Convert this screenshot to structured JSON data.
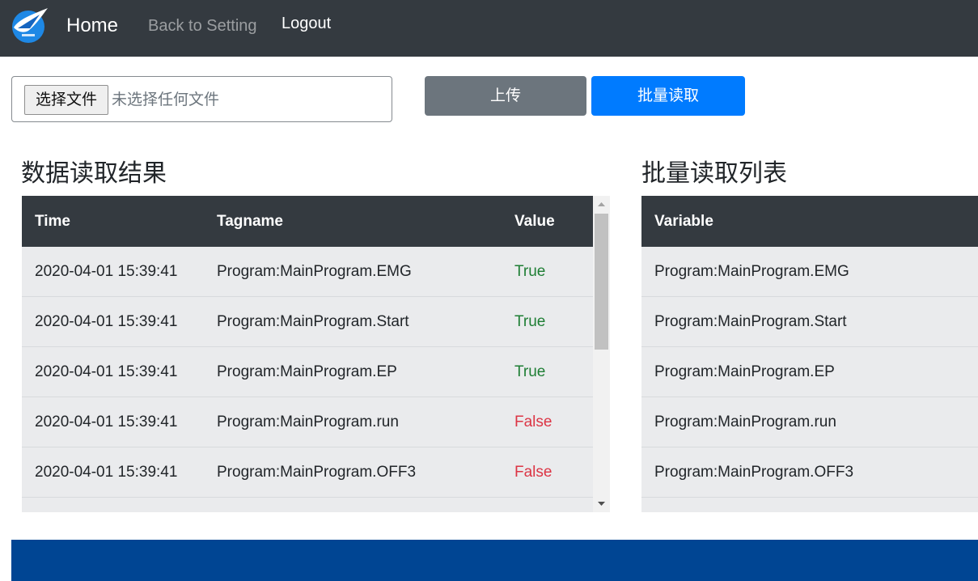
{
  "nav": {
    "home": "Home",
    "back": "Back to Setting",
    "logout": "Logout"
  },
  "file": {
    "button_label": "选择文件",
    "status": "未选择任何文件"
  },
  "buttons": {
    "upload": "上传",
    "batch_read": "批量读取"
  },
  "results": {
    "title": "数据读取结果",
    "columns": [
      "Time",
      "Tagname",
      "Value"
    ],
    "rows": [
      {
        "time": "2020-04-01 15:39:41",
        "tag": "Program:MainProgram.EMG",
        "value": "True"
      },
      {
        "time": "2020-04-01 15:39:41",
        "tag": "Program:MainProgram.Start",
        "value": "True"
      },
      {
        "time": "2020-04-01 15:39:41",
        "tag": "Program:MainProgram.EP",
        "value": "True"
      },
      {
        "time": "2020-04-01 15:39:41",
        "tag": "Program:MainProgram.run",
        "value": "False"
      },
      {
        "time": "2020-04-01 15:39:41",
        "tag": "Program:MainProgram.OFF3",
        "value": "False"
      }
    ]
  },
  "batch_list": {
    "title": "批量读取列表",
    "columns": [
      "Variable"
    ],
    "rows": [
      "Program:MainProgram.EMG",
      "Program:MainProgram.Start",
      "Program:MainProgram.EP",
      "Program:MainProgram.run",
      "Program:MainProgram.OFF3"
    ]
  },
  "colors": {
    "navbar": "#343a40",
    "primary": "#007bff",
    "secondary": "#6c757d",
    "true_value": "#1e7e34",
    "false_value": "#dc3545",
    "footer": "#004593"
  },
  "icons": {
    "logo": "airplane-logo-icon",
    "scroll_up": "scroll-up-arrow-icon",
    "scroll_down": "scroll-down-arrow-icon"
  }
}
